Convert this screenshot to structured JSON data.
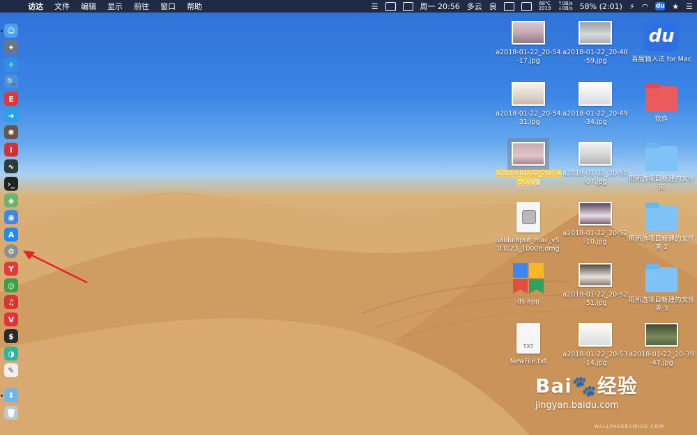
{
  "menubar": {
    "apple_glyph": "",
    "menus": [
      "访达",
      "文件",
      "编辑",
      "显示",
      "前往",
      "窗口",
      "帮助"
    ],
    "status": {
      "clock": "周一 20:56",
      "weather": "多云",
      "air_quality": "良",
      "temperature": "68℃",
      "year": "2019",
      "net_up": "↑0B/s",
      "net_down": "↓0B/s",
      "battery": "58% (2:01)",
      "bolt": "⚡",
      "wifi": "◠",
      "du": "du",
      "star": "★",
      "list": "☰"
    }
  },
  "dock": {
    "items": [
      {
        "name": "finder-icon",
        "glyph": "☺",
        "color": "#4aa3ef"
      },
      {
        "name": "launchpad-icon",
        "glyph": "✦",
        "color": "#6b7786"
      },
      {
        "name": "safari-icon",
        "glyph": "✧",
        "color": "#2f8fe3"
      },
      {
        "name": "preview-icon",
        "glyph": "🔍",
        "color": "#4a90d9"
      },
      {
        "name": "app-red-icon",
        "glyph": "E",
        "color": "#e0373a"
      },
      {
        "name": "migrate-icon",
        "glyph": "➜",
        "color": "#2aa0e8"
      },
      {
        "name": "spider-icon",
        "glyph": "✺",
        "color": "#6a5648"
      },
      {
        "name": "netease-icon",
        "glyph": "i",
        "color": "#d0323a"
      },
      {
        "name": "activity-icon",
        "glyph": "∿",
        "color": "#2d3a3a"
      },
      {
        "name": "terminal-icon",
        "glyph": "›_",
        "color": "#222222"
      },
      {
        "name": "maps-icon",
        "glyph": "◈",
        "color": "#6db26d"
      },
      {
        "name": "siri-icon",
        "glyph": "◉",
        "color": "#3f87e0"
      },
      {
        "name": "appstore-icon",
        "glyph": "A",
        "color": "#1f8bf0"
      },
      {
        "name": "system-preferences-icon",
        "glyph": "⚙",
        "color": "#8a8f96"
      },
      {
        "name": "yandex-icon",
        "glyph": "Y",
        "color": "#e23a36"
      },
      {
        "name": "chrome-icon",
        "glyph": "◎",
        "color": "#3b9f4a"
      },
      {
        "name": "music-icon",
        "glyph": "♫",
        "color": "#d83434"
      },
      {
        "name": "vivaldi-icon",
        "glyph": "V",
        "color": "#e2323a"
      },
      {
        "name": "console-icon",
        "glyph": "$",
        "color": "#2a2a2a"
      },
      {
        "name": "cleaner-icon",
        "glyph": "◑",
        "color": "#2bb5a4"
      },
      {
        "name": "textedit-icon",
        "glyph": "✎",
        "color": "#efefef"
      },
      {
        "name": "downloads-folder-icon",
        "glyph": "⬇",
        "color": "#6eb6ef"
      },
      {
        "name": "trash-icon",
        "glyph": "🗑",
        "color": "#bfc6cc"
      }
    ]
  },
  "desktop": {
    "items": [
      {
        "label": "a2018-01-22_20-54-17.jpg",
        "type": "image",
        "selected": false
      },
      {
        "label": "a2018-01-22_20-48-59.jpg",
        "type": "image",
        "selected": false
      },
      {
        "label": "百度输入法 for Mac",
        "type": "app-du",
        "selected": false
      },
      {
        "label": "a2018-01-22_20-54-31.jpg",
        "type": "image",
        "selected": false
      },
      {
        "label": "a2018-01-22_20-49-34.jpg",
        "type": "image",
        "selected": false
      },
      {
        "label": "软件",
        "type": "folder-red",
        "selected": false
      },
      {
        "label": "a2018-01-22_20-54-50.jpg",
        "type": "image",
        "selected": true
      },
      {
        "label": "a2018-01-22_20-50-07.jpg",
        "type": "image",
        "selected": false
      },
      {
        "label": "用所选项目新建的文件夹",
        "type": "folder-blue",
        "selected": false
      },
      {
        "label": "baiduinput_mac_v5.0.0.23_1000e.dmg",
        "type": "dmg",
        "selected": false
      },
      {
        "label": "a2018-01-22_20-52-10.jpg",
        "type": "image",
        "selected": false
      },
      {
        "label": "用所选项目新建的文件夹 2",
        "type": "folder-blue",
        "selected": false
      },
      {
        "label": "ds.app",
        "type": "app-ds",
        "selected": false
      },
      {
        "label": "a2018-01-22_20-52-51.jpg",
        "type": "image",
        "selected": false
      },
      {
        "label": "用所选项目新建的文件夹 3",
        "type": "folder-blue",
        "selected": false
      },
      {
        "label": "NewFile.txt",
        "type": "txt",
        "selected": false
      },
      {
        "label": "a2018-01-22_20-53-14.jpg",
        "type": "image",
        "selected": false
      },
      {
        "label": "a2018-01-22_20-39-47.jpg",
        "type": "image",
        "selected": false
      }
    ]
  },
  "file_icons": {
    "txt_ext": "TXT",
    "du_logo": "du"
  },
  "watermark": {
    "brand": "Bai🐾经验",
    "url": "jingyan.baidu.com",
    "wallpaper": "WALLPAPERSWIDE.COM"
  },
  "colors": {
    "annotation_arrow": "#e8202a",
    "menubar_bg": "#1f2a44",
    "selection_highlight": "#f4d15a"
  }
}
